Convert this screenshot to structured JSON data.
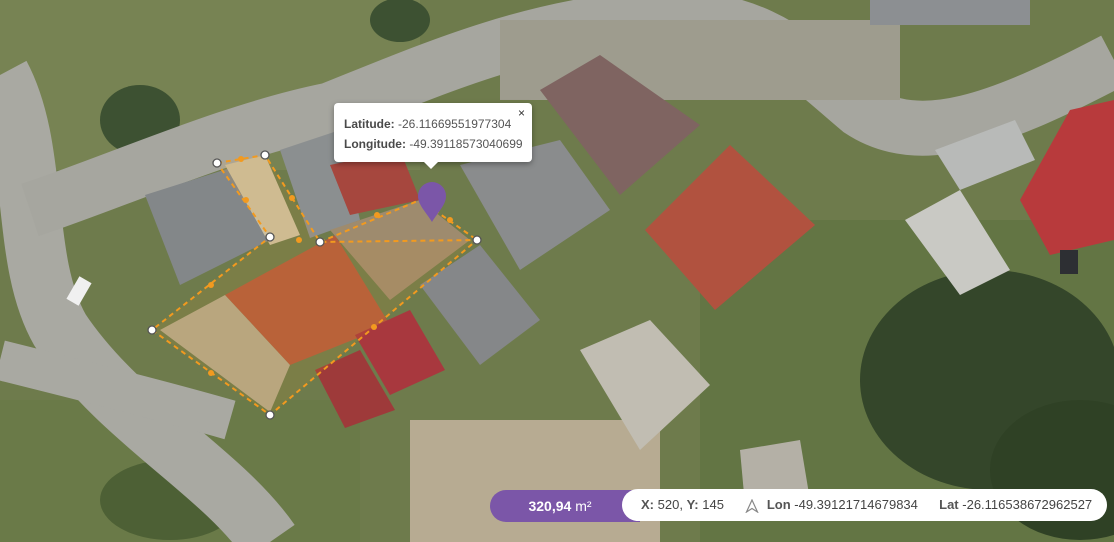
{
  "popup": {
    "latitude_label": "Latitude:",
    "latitude_value": "-26.11669551977304",
    "longitude_label": "Longitude:",
    "longitude_value": "-49.39118573040699",
    "close_glyph": "×"
  },
  "area": {
    "value": "320,94",
    "unit": "m²"
  },
  "cursor": {
    "x_label": "X:",
    "x_value": "520,",
    "y_label": "Y:",
    "y_value": "145",
    "lon_label": "Lon",
    "lon_value": "-49.39121714679834",
    "lat_label": "Lat",
    "lat_value": "-26.116538672962527",
    "nav_icon": "navigation-arrow-icon"
  },
  "colors": {
    "accent": "#7b56a8",
    "polygon": "#f29a1f",
    "marker": "#7b56a8"
  }
}
